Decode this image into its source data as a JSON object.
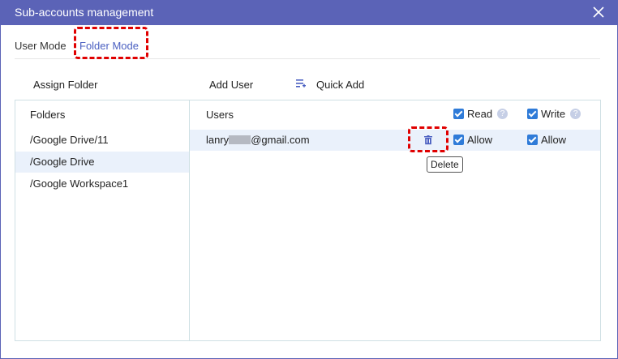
{
  "window": {
    "title": "Sub-accounts management"
  },
  "tabs": [
    {
      "label": "User Mode"
    },
    {
      "label": "Folder Mode",
      "active": true
    }
  ],
  "toolbar": {
    "assign_folder": "Assign Folder",
    "add_user": "Add User",
    "quick_add": "Quick Add"
  },
  "folders": {
    "header": "Folders",
    "items": [
      {
        "label": "/Google Drive/11"
      },
      {
        "label": "/Google Drive",
        "selected": true
      },
      {
        "label": "/Google Workspace1"
      }
    ]
  },
  "users": {
    "header": "Users",
    "read_label": "Read",
    "write_label": "Write",
    "help_glyph": "?",
    "rows": [
      {
        "email_prefix": "lanry",
        "email_suffix": "@gmail.com",
        "read_allow": "Allow",
        "write_allow": "Allow"
      }
    ]
  },
  "tooltip": {
    "text": "Delete"
  },
  "colors": {
    "titlebar": "#5b63b7",
    "accent": "#4a5fc1",
    "checkbox": "#2f7bd8",
    "highlight": "#e00000",
    "selected_row": "#eaf1fb"
  },
  "icons": [
    "close-icon",
    "quick-add-icon",
    "trash-icon",
    "checkbox-checked-icon",
    "help-icon"
  ]
}
